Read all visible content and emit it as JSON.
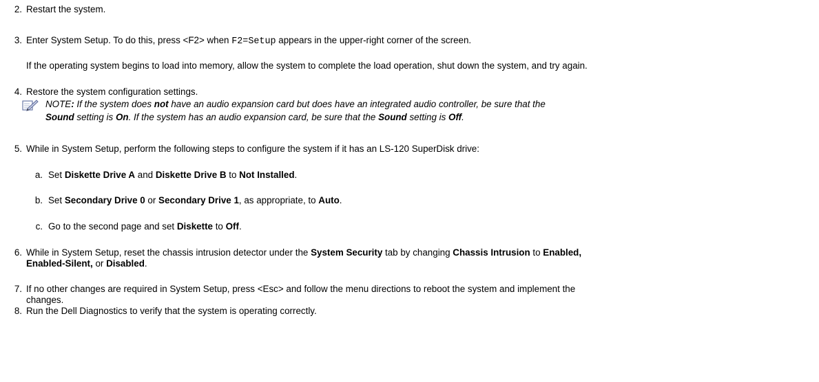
{
  "steps": {
    "s2": {
      "num": "2.",
      "text": "Restart the system."
    },
    "s3": {
      "num": "3.",
      "t1": "Enter System Setup. To do this, press <F2> when ",
      "code": "F2=Setup",
      "t2": " appears in the upper-right corner of the screen.",
      "para": "If the operating system begins to load into memory, allow the system to complete the load operation, shut down the system, and try again."
    },
    "s4": {
      "num": "4.",
      "text": "Restore the system configuration settings."
    },
    "note": {
      "l1_a": "NOTE",
      "l1_b": ": ",
      "l1_c": "If the system does ",
      "l1_d": "not",
      "l1_e": " have an audio expansion card but does have an integrated audio controller, be sure that the",
      "l2_a": "Sound",
      "l2_b": " setting is ",
      "l2_c": "On",
      "l2_d": ". If the system has an audio expansion card, be sure that the ",
      "l2_e": "Sound",
      "l2_f": " setting is ",
      "l2_g": "Off",
      "l2_h": "."
    },
    "s5": {
      "num": "5.",
      "text": "While in System Setup, perform the following steps to configure the system if it has an LS-120 SuperDisk drive:"
    },
    "sa": {
      "letter": "a.",
      "t1": "Set ",
      "b1": "Diskette Drive A",
      "t2": " and ",
      "b2": "Diskette Drive B",
      "t3": " to ",
      "b3": "Not Installed",
      "t4": "."
    },
    "sb": {
      "letter": "b.",
      "t1": "Set ",
      "b1": "Secondary Drive 0",
      "t2": " or ",
      "b2": "Secondary Drive 1",
      "t3": ", as appropriate, to ",
      "b3": "Auto",
      "t4": "."
    },
    "sc": {
      "letter": "c.",
      "t1": "Go to the second page and set ",
      "b1": "Diskette",
      "t2": " to ",
      "b2": "Off",
      "t3": "."
    },
    "s6": {
      "num": "6.",
      "t1": "While in System Setup, reset the chassis intrusion detector under the ",
      "b1": "System Security",
      "t2": " tab by changing ",
      "b2": "Chassis Intrusion",
      "t3": " to ",
      "b3": "Enabled,",
      "l2_b1": "Enabled-Silent,",
      "l2_t1": " or ",
      "l2_b2": "Disabled",
      "l2_t2": "."
    },
    "s7": {
      "num": "7.",
      "l1": "If no other changes are required in System Setup, press <Esc> and follow the menu directions to reboot the system and implement the",
      "l2": "changes."
    },
    "s8": {
      "num": "8.",
      "text": "Run the Dell Diagnostics to verify that the system is operating correctly."
    }
  }
}
